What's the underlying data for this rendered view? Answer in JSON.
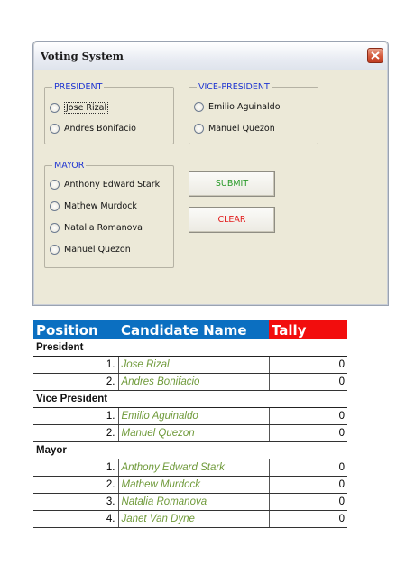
{
  "window": {
    "title": "Voting System"
  },
  "form": {
    "president": {
      "legend": "PRESIDENT",
      "options": [
        "Jose Rizal",
        "Andres Bonifacio"
      ]
    },
    "vice_president": {
      "legend": "VICE-PRESIDENT",
      "options": [
        "Emilio Aguinaldo",
        "Manuel Quezon"
      ]
    },
    "mayor": {
      "legend": "MAYOR",
      "options": [
        "Anthony Edward Stark",
        "Mathew Murdock",
        "Natalia Romanova",
        "Manuel Quezon"
      ]
    },
    "submit_label": "SUBMIT",
    "clear_label": "CLEAR"
  },
  "table": {
    "headers": {
      "position": "Position",
      "candidate": "Candidate Name",
      "tally": "Tally"
    },
    "groups": [
      {
        "name": "President",
        "rows": [
          {
            "num": "1.",
            "candidate": "Jose Rizal",
            "tally": "0"
          },
          {
            "num": "2.",
            "candidate": "Andres Bonifacio",
            "tally": "0"
          }
        ]
      },
      {
        "name": "Vice President",
        "rows": [
          {
            "num": "1.",
            "candidate": "Emilio Aguinaldo",
            "tally": "0"
          },
          {
            "num": "2.",
            "candidate": "Manuel Quezon",
            "tally": "0"
          }
        ]
      },
      {
        "name": "Mayor",
        "rows": [
          {
            "num": "1.",
            "candidate": "Anthony Edward Stark",
            "tally": "0"
          },
          {
            "num": "2.",
            "candidate": "Mathew Murdock",
            "tally": "0"
          },
          {
            "num": "3.",
            "candidate": "Natalia Romanova",
            "tally": "0"
          },
          {
            "num": "4.",
            "candidate": "Janet Van Dyne",
            "tally": "0"
          }
        ]
      }
    ]
  },
  "colors": {
    "header_blue": "#0b6fc1",
    "header_red": "#f20d0d",
    "candidate_green": "#6f9a3a",
    "legend_blue": "#1f35d1"
  }
}
